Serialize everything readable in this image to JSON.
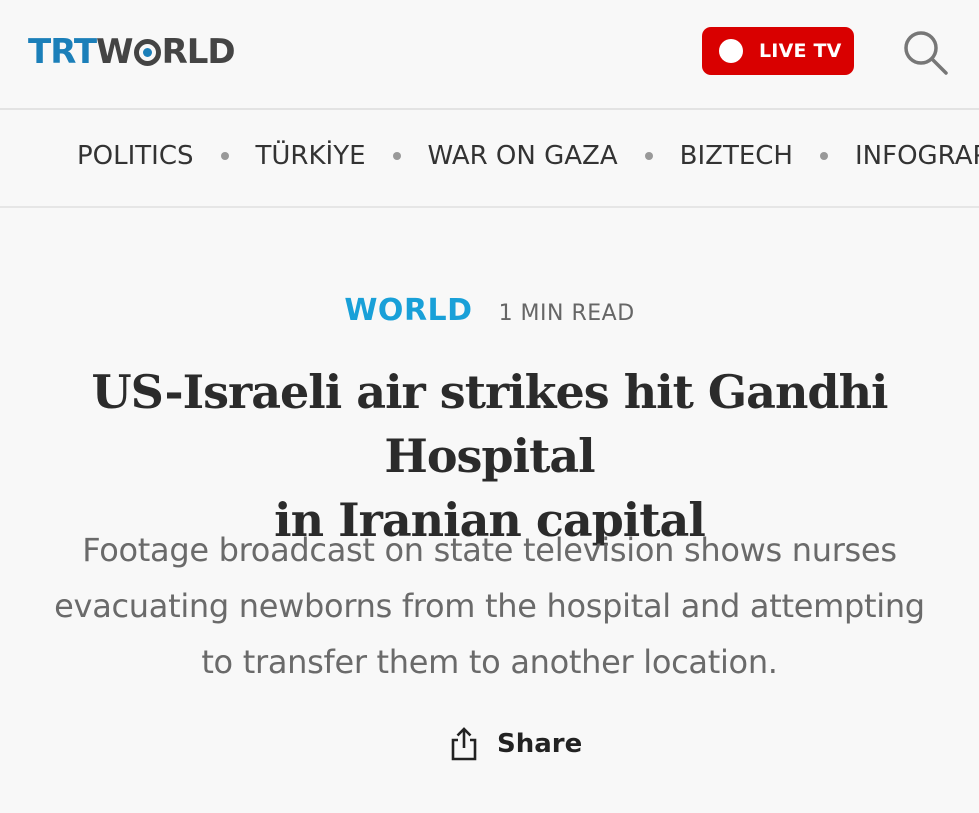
{
  "header": {
    "logo": {
      "part1": "TRT",
      "part2_pre": "W",
      "part2_post": "RLD"
    },
    "live_button": {
      "label": "LIVE TV"
    },
    "search": {
      "icon": "search-icon"
    }
  },
  "nav": {
    "items": [
      {
        "label": "POLITICS"
      },
      {
        "label": "TÜRKİYE"
      },
      {
        "label": "WAR ON GAZA"
      },
      {
        "label": "BIZTECH"
      },
      {
        "label": "INFOGRAPHICS"
      }
    ]
  },
  "article": {
    "category": "WORLD",
    "read_time": "1 MIN READ",
    "headline_line1": "US-Israeli air strikes hit Gandhi Hospital",
    "headline_line2": "in Iranian capital",
    "standfirst_line1": "Footage broadcast on state television shows nurses",
    "standfirst_line2": "evacuating newborns from the hospital and attempting",
    "standfirst_line3": "to transfer them to another location.",
    "share_label": "Share"
  },
  "colors": {
    "brand_blue": "#1b7fb9",
    "live_red": "#d90000",
    "category_blue": "#19a0d8",
    "background": "#f8f8f8"
  }
}
